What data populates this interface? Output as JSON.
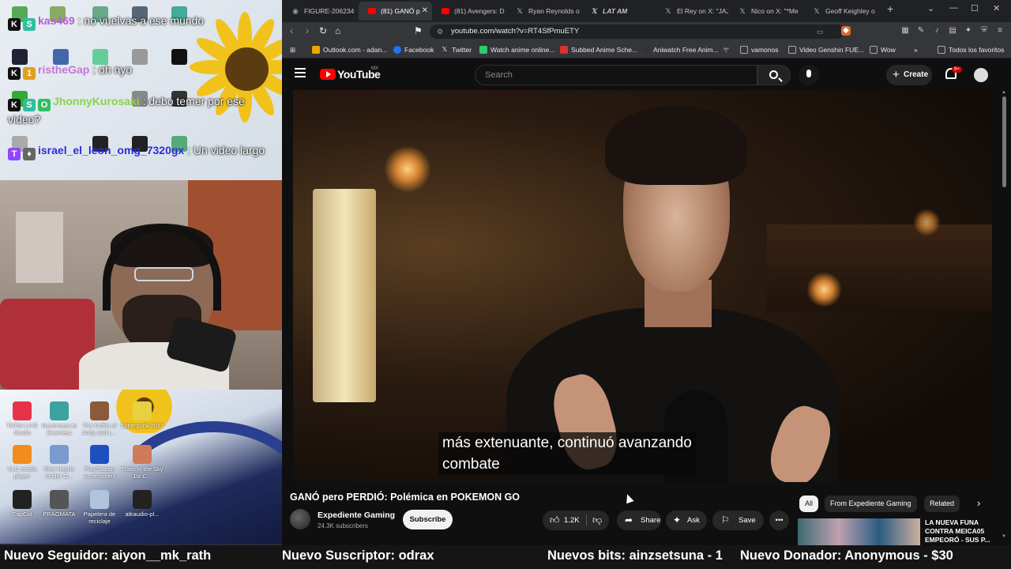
{
  "chat": {
    "messages": [
      {
        "user": "kas469",
        "user_color": "#b85cd6",
        "sep": " : ",
        "text": "no vuelvas a ese mundo"
      },
      {
        "user": "ristheGap",
        "user_color": "#c476d9",
        "sep": " : ",
        "text": "oh nyo"
      },
      {
        "user": "JhonnyKurosaki",
        "user_color": "#8ad34a",
        "sep": " : ",
        "text": "debo temer por ese video?"
      },
      {
        "user": "israel_el_leon_omg_7320gx",
        "user_color": "#2d2dd8",
        "sep": " : ",
        "text": "Un video largo"
      }
    ]
  },
  "desktop_icons": [
    {
      "label": "TikTok LIVE Studio",
      "color": "#e6334a"
    },
    {
      "label": "Neverness to Everness",
      "color": "#3aa3a0"
    },
    {
      "label": "The Coffin of Andy and L...",
      "color": "#8a5a3a"
    },
    {
      "label": "Cyberpunk 2077",
      "color": "#e8d040"
    },
    {
      "label": "VLC media player",
      "color": "#f28c1e"
    },
    {
      "label": "Five Hearts Under O...",
      "color": "#7a9ad0"
    },
    {
      "label": "PlayStation Accessories",
      "color": "#1f4fbf"
    },
    {
      "label": "Trails in the Sky 1st C...",
      "color": "#d07a5a"
    },
    {
      "label": "CapCut",
      "color": "#222222"
    },
    {
      "label": "PRAGMATA",
      "color": "#555555"
    },
    {
      "label": "Papelera de reciclaje",
      "color": "#b0c4de"
    },
    {
      "label": "atkaudio-pl...",
      "color": "#222222"
    }
  ],
  "browser": {
    "tabs": [
      {
        "label": "FIGURE-206234",
        "icon": "globe-icon"
      },
      {
        "label": "(81) GANÓ p",
        "icon": "youtube-icon",
        "active": true
      },
      {
        "label": "(81) Avengers: D",
        "icon": "youtube-icon"
      },
      {
        "label": "Ryan Reynolds o",
        "icon": "x-icon"
      },
      {
        "label": "LAT AM",
        "icon": "x-icon"
      },
      {
        "label": "El Rey on X: \"JAJ",
        "icon": "x-icon"
      },
      {
        "label": "Nico on X: \"*Me",
        "icon": "x-icon"
      },
      {
        "label": "Geoff Keighley o",
        "icon": "x-icon"
      }
    ],
    "url": "youtube.com/watch?v=RT4SfPmuETY",
    "bookmarks": [
      {
        "label": "Outlook.com - adan...",
        "color": "#f1a400"
      },
      {
        "label": "Facebook",
        "color": "#1877f2"
      },
      {
        "label": "Twitter",
        "color": "#000000"
      },
      {
        "label": "Watch anime online...",
        "color": "#2ecc71"
      },
      {
        "label": "Subbed Anime Sche...",
        "color": "#e03030"
      },
      {
        "label": "Aniwatch Free Anim...",
        "color": "#333333"
      },
      {
        "label": "vamonos",
        "color": "folder"
      },
      {
        "label": "Video Genshin FUE...",
        "color": "folder"
      },
      {
        "label": "Wow",
        "color": "folder"
      }
    ],
    "all_bookmarks": "Todos los favoritos"
  },
  "youtube": {
    "wordmark": "YouTube",
    "region": "MX",
    "search_placeholder": "Search",
    "create_label": "Create",
    "notifications": "9+",
    "subtitles": [
      "más extenuante, continuó avanzando",
      "combate"
    ],
    "video_title": "GANÓ pero PERDIÓ: Polémica en POKEMON GO",
    "channel_name": "Expediente Gaming",
    "channel_subs": "24.3K subscribers",
    "subscribe_label": "Subscribe",
    "likes": "1.2K",
    "share_label": "Share",
    "ask_label": "Ask",
    "save_label": "Save",
    "chips": [
      "All",
      "From Expediente Gaming",
      "Related"
    ],
    "rec_title": "LA NUEVA FUNA CONTRA MEICA05 EMPEORÓ - SUS P..."
  },
  "ticker": {
    "follower": "Nuevo Seguidor: aiyon__mk_rath",
    "subscriber": "Nuevo Suscriptor: odrax",
    "bits": "Nuevos bits: ainzsetsuna - 1",
    "donor": "Nuevo Donador: Anonymous - $30"
  }
}
